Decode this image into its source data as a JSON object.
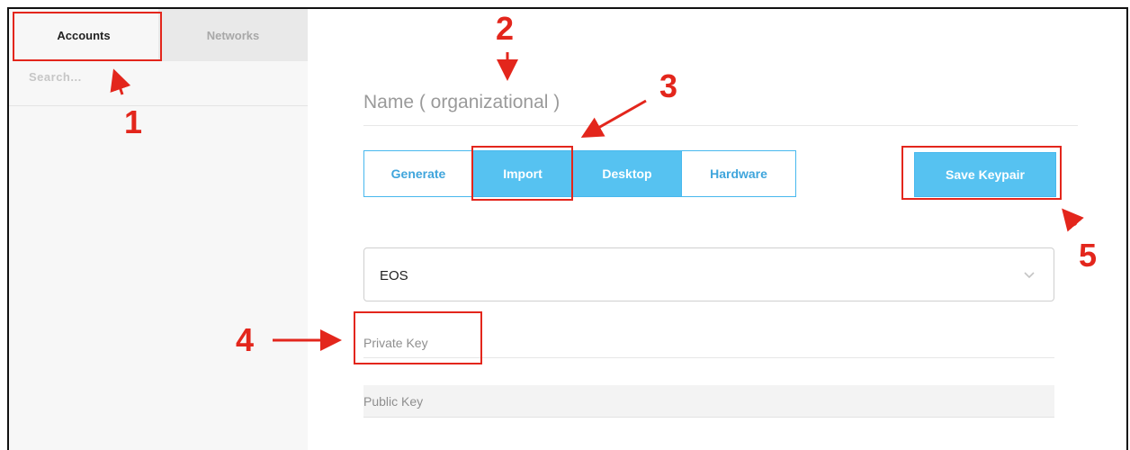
{
  "sidebar": {
    "tabs": [
      {
        "label": "Accounts"
      },
      {
        "label": "Networks"
      }
    ],
    "search": {
      "placeholder": "Search..."
    }
  },
  "main": {
    "name_input": {
      "placeholder": "Name ( organizational )",
      "value": ""
    },
    "key_source_buttons": [
      {
        "label": "Generate",
        "active": false
      },
      {
        "label": "Import",
        "active": true
      },
      {
        "label": "Desktop",
        "active": true
      },
      {
        "label": "Hardware",
        "active": false
      }
    ],
    "save_label": "Save Keypair",
    "blockchain_select": {
      "value": "EOS"
    },
    "private_key": {
      "placeholder": "Private Key",
      "value": ""
    },
    "public_key": {
      "placeholder": "Public Key",
      "value": ""
    }
  },
  "annotations": [
    "1",
    "2",
    "3",
    "4",
    "5"
  ],
  "colors": {
    "accent": "#56c2f1",
    "accent_text": "#3fa5dc",
    "annotation": "#e3261c"
  }
}
